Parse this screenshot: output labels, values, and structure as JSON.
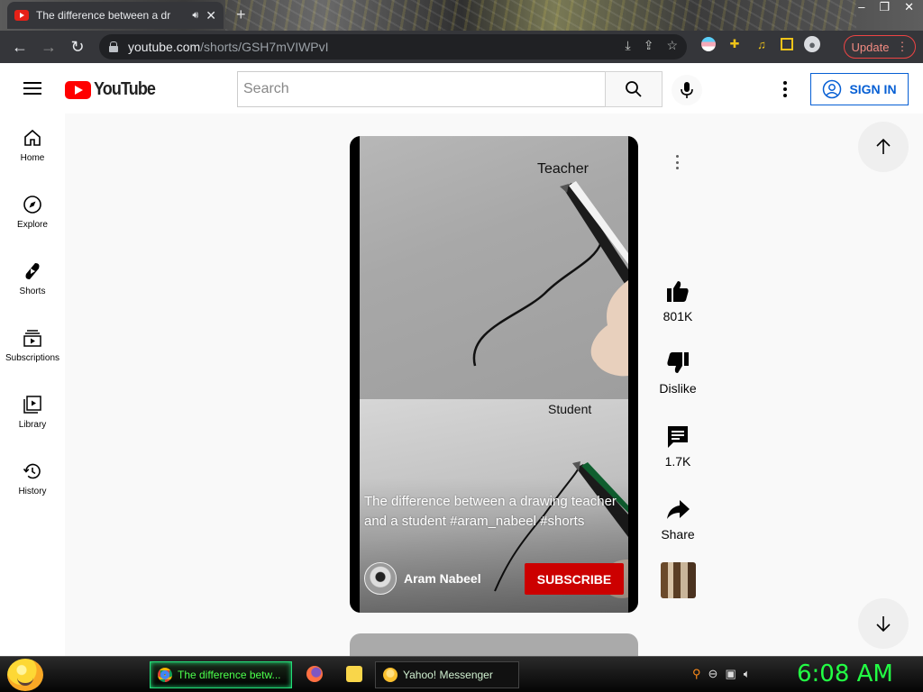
{
  "browser": {
    "tab_title": "The difference between a dr",
    "url_host": "youtube.com",
    "url_path": "/shorts/GSH7mVIWPvI",
    "update_label": "Update"
  },
  "youtube": {
    "logo_text": "YouTube",
    "search_placeholder": "Search",
    "sign_in_label": "SIGN IN",
    "nav": [
      {
        "label": "Home",
        "icon": "home-icon"
      },
      {
        "label": "Explore",
        "icon": "compass-icon"
      },
      {
        "label": "Shorts",
        "icon": "shorts-icon"
      },
      {
        "label": "Subscriptions",
        "icon": "subscriptions-icon"
      },
      {
        "label": "Library",
        "icon": "library-icon"
      },
      {
        "label": "History",
        "icon": "history-icon"
      }
    ]
  },
  "short": {
    "label_top": "Teacher",
    "label_bottom": "Student",
    "caption": "The difference between a drawing teacher and a student #aram_nabeel #shorts",
    "channel_name": "Aram Nabeel",
    "subscribe_label": "SUBSCRIBE",
    "likes": "801K",
    "dislike_label": "Dislike",
    "comments": "1.7K",
    "share_label": "Share"
  },
  "taskbar": {
    "active_task": "The difference betw...",
    "yahoo_task": "Yahoo! Messenger",
    "clock": "6:08 AM"
  },
  "colors": {
    "yt_red": "#ff0000",
    "subscribe_red": "#cc0000",
    "link_blue": "#065fd4",
    "clock_green": "#22ff44"
  }
}
